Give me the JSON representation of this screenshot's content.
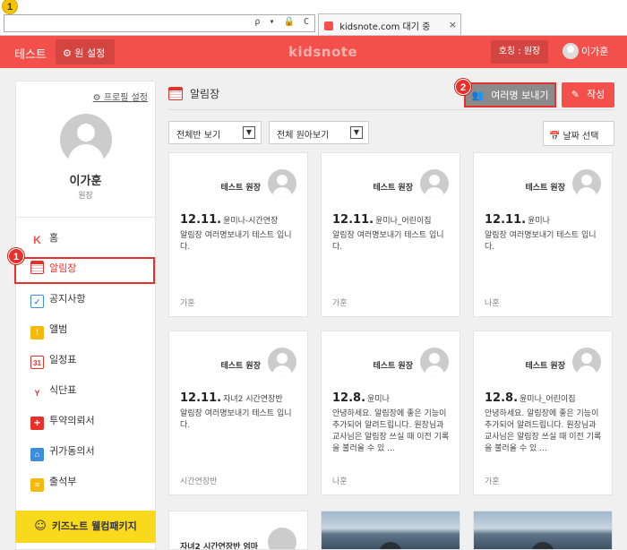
{
  "browser": {
    "tab_title": "kidsnote.com 대기 중",
    "address_icons": "ρ ▾ 🔒 C",
    "tab_close": "×"
  },
  "markers": [
    "1",
    "1",
    "2"
  ],
  "header": {
    "title": "테스트",
    "settings_label": "⚙ 원 설정",
    "logo": "kidsnote",
    "role_label": "호칭 : 원장",
    "user_name": "이가훈"
  },
  "sidebar": {
    "profile_settings": "⚙ 프로필 설정",
    "user_name": "이가훈",
    "user_role": "원장",
    "items": [
      {
        "label": "홈",
        "icon": "K",
        "color": "#f4504b"
      },
      {
        "label": "알림장",
        "icon": "",
        "color": "#e8302a",
        "active": true
      },
      {
        "label": "공지사항",
        "icon": "✓",
        "color": "#3c8ed8"
      },
      {
        "label": "앨범",
        "icon": "!",
        "color": "#f5b80d"
      },
      {
        "label": "일정표",
        "icon": "31",
        "color": "#e8302a"
      },
      {
        "label": "식단표",
        "icon": "Y",
        "color": "#e8302a"
      },
      {
        "label": "투약의뢰서",
        "icon": "+",
        "color": "#e8302a"
      },
      {
        "label": "귀가동의서",
        "icon": "⌂",
        "color": "#3c8ed8"
      },
      {
        "label": "출석부",
        "icon": "≡",
        "color": "#f5b80d"
      }
    ],
    "welcome_package": "키즈노트 웰컴패키지",
    "welcome_icon": "☺"
  },
  "main": {
    "page_title": "알림장",
    "multi_send_label": "여러명 보내기",
    "write_label": "작성",
    "filter_class": "전체반 보기",
    "filter_child": "전체 원아보기",
    "date_select": "날짜 선택"
  },
  "cards": [
    {
      "author": "테스트 원장",
      "date": "12.11.",
      "cls": "윤미나-시간연장",
      "text": "알림장 여러명보내기 테스트 입니다.",
      "foot": "가훈"
    },
    {
      "author": "테스트 원장",
      "date": "12.11.",
      "cls": "윤미나_어린이집",
      "text": "알림장 여러명보내기 테스트 입니다.",
      "foot": "가훈"
    },
    {
      "author": "테스트 원장",
      "date": "12.11.",
      "cls": "윤미나",
      "text": "알림장 여러명보내기 테스트 입니다.",
      "foot": "나훈"
    },
    {
      "author": "테스트 원장",
      "date": "12.11.",
      "cls": "자녀2 시간연장반",
      "text": "알림장 여러명보내기 테스트 입니다.",
      "foot": "시간연장반"
    },
    {
      "author": "테스트 원장",
      "date": "12.8.",
      "cls": "윤미나",
      "text": "안녕하세요. 알림장에 좋은 기능이 추가되어 알려드립니다. 원장님과 교사님은 알림장 쓰실 때 이전 기록을 불러올 수 있 ...",
      "foot": "나훈"
    },
    {
      "author": "테스트 원장",
      "date": "12.8.",
      "cls": "윤미나_어린이집",
      "text": "안녕하세요. 알림장에 좋은 기능이 추가되어 알려드립니다. 원장님과 교사님은 알림장 쓰실 때 이전 기록을 불러올 수 있 ...",
      "foot": "가훈"
    }
  ],
  "bottom_card": {
    "author": "자녀2 시간연장반 엄마"
  }
}
